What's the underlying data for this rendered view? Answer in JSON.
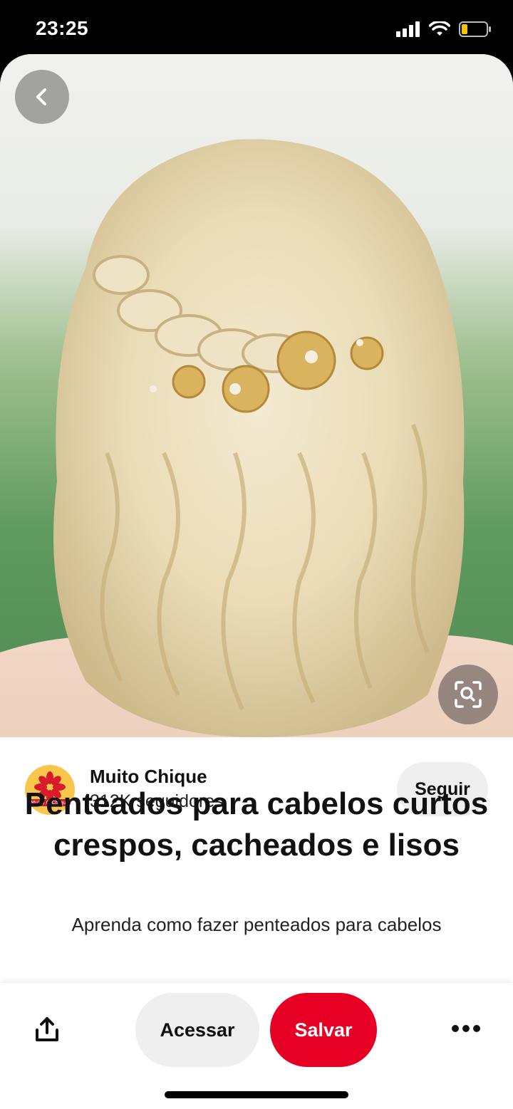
{
  "status_bar": {
    "time": "23:25",
    "icons": [
      "cellular-signal-icon",
      "wifi-icon",
      "battery-low-icon"
    ],
    "battery_color": "#f4c20d"
  },
  "pin": {
    "image_icons": [
      "back-chevron-icon",
      "visual-search-icon"
    ],
    "creator": {
      "name": "Muito Chique",
      "followers": "312K seguidores",
      "avatar_text": "Muito O Chique",
      "follow_label": "Seguir"
    },
    "title": "Penteados para cabelos curtos crespos, cacheados e lisos",
    "description": "Aprenda como fazer penteados para cabelos"
  },
  "action_bar": {
    "access_label": "Acessar",
    "save_label": "Salvar",
    "icons": [
      "share-icon",
      "more-options-icon"
    ]
  },
  "colors": {
    "save_button": "#e60023",
    "neutral_button": "#efefef"
  }
}
